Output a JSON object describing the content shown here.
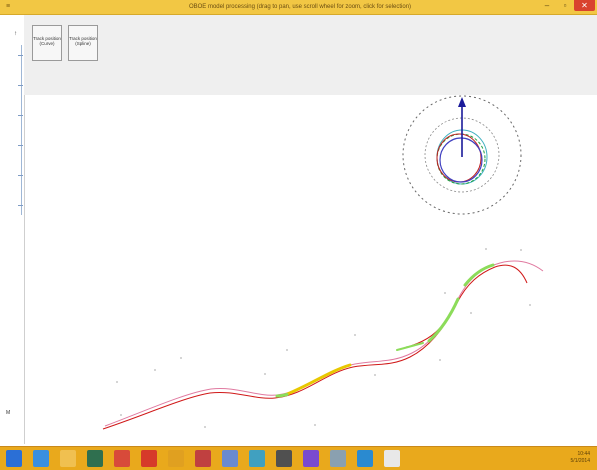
{
  "window": {
    "title": "OBOE model processing (drag to pan, use scroll wheel for zoom, click for selection)",
    "minimize_glyph": "–",
    "maximize_glyph": "▫",
    "close_glyph": "✕",
    "system_icon_glyph": "≡"
  },
  "toolbar": {
    "button1_label": "Track position (Curve)",
    "button2_label": "Track position (Spline)"
  },
  "left_strip": {
    "top_mark": "↑",
    "bottom_label": "M"
  },
  "colors": {
    "titlebar": "#f2c744",
    "taskbar": "#e9a91c",
    "curve_red": "#d01818",
    "curve_pink": "#e07aa0",
    "highlight_green": "#8cdc5a",
    "highlight_yellow": "#e8c800",
    "compass_arrow": "#1a1a9a",
    "compass_dashed": "#666666",
    "compass_blue": "#4040c0",
    "compass_green": "#20a040",
    "compass_red": "#c02020",
    "compass_cyan": "#40b0c0"
  },
  "taskbar": {
    "icons": [
      {
        "name": "start-icon",
        "color": "#2b6fd6"
      },
      {
        "name": "ie-icon",
        "color": "#3a8fe0"
      },
      {
        "name": "explorer-icon",
        "color": "#f0c050"
      },
      {
        "name": "app-icon-1",
        "color": "#2f6f4f"
      },
      {
        "name": "chrome-icon",
        "color": "#d84a3a"
      },
      {
        "name": "app-icon-2",
        "color": "#d63a2a"
      },
      {
        "name": "app-icon-3",
        "color": "#e0a020"
      },
      {
        "name": "app-icon-4",
        "color": "#c04040"
      },
      {
        "name": "app-icon-5",
        "color": "#6a8ad0"
      },
      {
        "name": "app-icon-6",
        "color": "#40a0c0"
      },
      {
        "name": "app-icon-7",
        "color": "#505050"
      },
      {
        "name": "visual-studio-icon",
        "color": "#7a4ad0"
      },
      {
        "name": "app-icon-8",
        "color": "#8aa0b0"
      },
      {
        "name": "app-icon-9",
        "color": "#2a8ad0"
      },
      {
        "name": "app-icon-10",
        "color": "#e8e8e8"
      }
    ],
    "clock_time": "10:44",
    "clock_date": "5/1/2014"
  }
}
